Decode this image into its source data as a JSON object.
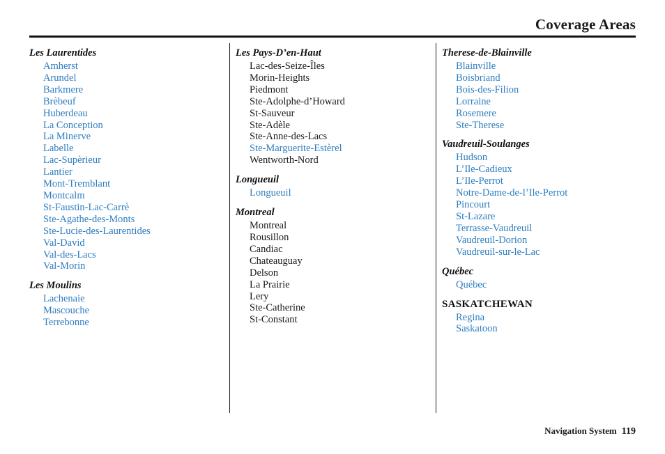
{
  "header": {
    "title": "Coverage Areas"
  },
  "footer": {
    "label": "Navigation System",
    "page_number": "119"
  },
  "colors": {
    "link_blue": "#2d7dc0",
    "text_black": "#1a1a1a",
    "rule": "#131313"
  },
  "columns": [
    {
      "groups": [
        {
          "heading": "Les Laurentides",
          "heading_style": "region",
          "cities": [
            {
              "name": "Amherst",
              "color": "blue"
            },
            {
              "name": "Arundel",
              "color": "blue"
            },
            {
              "name": "Barkmere",
              "color": "blue"
            },
            {
              "name": "Brèbeuf",
              "color": "blue"
            },
            {
              "name": "Huberdeau",
              "color": "blue"
            },
            {
              "name": "La Conception",
              "color": "blue"
            },
            {
              "name": "La Minerve",
              "color": "blue"
            },
            {
              "name": "Labelle",
              "color": "blue"
            },
            {
              "name": "Lac-Supèrieur",
              "color": "blue"
            },
            {
              "name": "Lantier",
              "color": "blue"
            },
            {
              "name": "Mont-Tremblant",
              "color": "blue"
            },
            {
              "name": "Montcalm",
              "color": "blue"
            },
            {
              "name": "St-Faustin-Lac-Carrè",
              "color": "blue"
            },
            {
              "name": "Ste-Agathe-des-Monts",
              "color": "blue"
            },
            {
              "name": "Ste-Lucie-des-Laurentides",
              "color": "blue"
            },
            {
              "name": "Val-David",
              "color": "blue"
            },
            {
              "name": "Val-des-Lacs",
              "color": "blue"
            },
            {
              "name": "Val-Morin",
              "color": "blue"
            }
          ]
        },
        {
          "heading": "Les Moulins",
          "heading_style": "region",
          "cities": [
            {
              "name": "Lachenaie",
              "color": "blue"
            },
            {
              "name": "Mascouche",
              "color": "blue"
            },
            {
              "name": "Terrebonne",
              "color": "blue"
            }
          ]
        }
      ]
    },
    {
      "groups": [
        {
          "heading": "Les Pays-D’en-Haut",
          "heading_style": "region",
          "cities": [
            {
              "name": "Lac-des-Seize-Îles",
              "color": "black"
            },
            {
              "name": "Morin-Heights",
              "color": "black"
            },
            {
              "name": "Piedmont",
              "color": "black"
            },
            {
              "name": "Ste-Adolphe-d’Howard",
              "color": "black"
            },
            {
              "name": "St-Sauveur",
              "color": "black"
            },
            {
              "name": "Ste-Adèle",
              "color": "black"
            },
            {
              "name": "Ste-Anne-des-Lacs",
              "color": "black"
            },
            {
              "name": "Ste-Marguerite-Estèrel",
              "color": "blue"
            },
            {
              "name": "Wentworth-Nord",
              "color": "black"
            }
          ]
        },
        {
          "heading": "Longueuil",
          "heading_style": "region",
          "cities": [
            {
              "name": "Longueuil",
              "color": "blue"
            }
          ]
        },
        {
          "heading": "Montreal",
          "heading_style": "region",
          "cities": [
            {
              "name": "Montreal",
              "color": "black"
            },
            {
              "name": "Rousillon",
              "color": "black"
            },
            {
              "name": "Candiac",
              "color": "black"
            },
            {
              "name": "Chateauguay",
              "color": "black"
            },
            {
              "name": "Delson",
              "color": "black"
            },
            {
              "name": "La Prairie",
              "color": "black"
            },
            {
              "name": "Lery",
              "color": "black"
            },
            {
              "name": "Ste-Catherine",
              "color": "black"
            },
            {
              "name": "St-Constant",
              "color": "black"
            }
          ]
        }
      ]
    },
    {
      "groups": [
        {
          "heading": "Therese-de-Blainville",
          "heading_style": "region",
          "cities": [
            {
              "name": "Blainville",
              "color": "blue"
            },
            {
              "name": "Boisbriand",
              "color": "blue"
            },
            {
              "name": "Bois-des-Filion",
              "color": "blue"
            },
            {
              "name": "Lorraine",
              "color": "blue"
            },
            {
              "name": "Rosemere",
              "color": "blue"
            },
            {
              "name": "Ste-Therese",
              "color": "blue"
            }
          ]
        },
        {
          "heading": "Vaudreuil-Soulanges",
          "heading_style": "region",
          "cities": [
            {
              "name": "Hudson",
              "color": "blue"
            },
            {
              "name": "L’Ile-Cadieux",
              "color": "blue"
            },
            {
              "name": "L’Ile-Perrot",
              "color": "blue"
            },
            {
              "name": "Notre-Dame-de-l’Ile-Perrot",
              "color": "blue"
            },
            {
              "name": "Pincourt",
              "color": "blue"
            },
            {
              "name": "St-Lazare",
              "color": "blue"
            },
            {
              "name": "Terrasse-Vaudreuil",
              "color": "blue"
            },
            {
              "name": "Vaudreuil-Dorion",
              "color": "blue"
            },
            {
              "name": "Vaudreuil-sur-le-Lac",
              "color": "blue"
            }
          ]
        },
        {
          "heading": "Québec",
          "heading_style": "region",
          "cities": [
            {
              "name": "Québec",
              "color": "blue"
            }
          ]
        },
        {
          "heading": "SASKATCHEWAN",
          "heading_style": "province",
          "cities": [
            {
              "name": "Regina",
              "color": "blue"
            },
            {
              "name": "Saskatoon",
              "color": "blue"
            }
          ]
        }
      ]
    }
  ]
}
